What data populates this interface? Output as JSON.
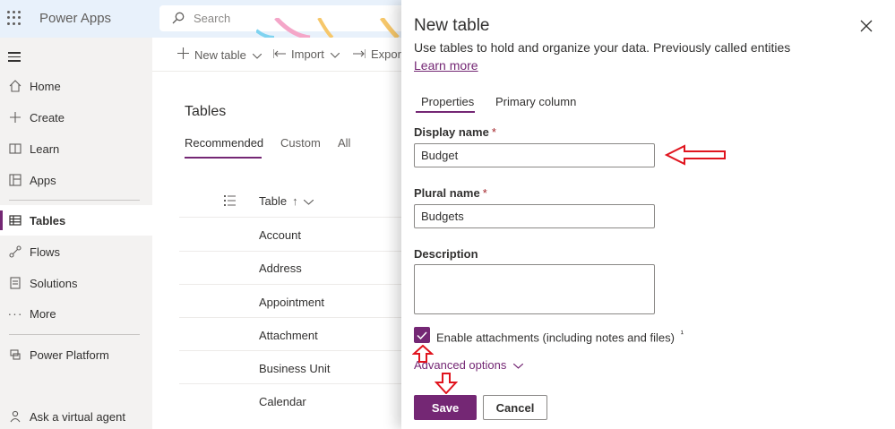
{
  "app": {
    "name": "Power Apps"
  },
  "search": {
    "placeholder": "Search"
  },
  "nav": {
    "items": [
      {
        "label": "Home",
        "icon": "home-icon"
      },
      {
        "label": "Create",
        "icon": "plus-icon"
      },
      {
        "label": "Learn",
        "icon": "book-icon"
      },
      {
        "label": "Apps",
        "icon": "apps-icon"
      },
      {
        "label": "Tables",
        "icon": "table-icon",
        "active": true
      },
      {
        "label": "Flows",
        "icon": "flow-icon"
      },
      {
        "label": "Solutions",
        "icon": "solutions-icon"
      },
      {
        "label": "More",
        "icon": "more-icon"
      },
      {
        "label": "Power Platform",
        "icon": "power-platform-icon"
      },
      {
        "label": "Ask a virtual agent",
        "icon": "agent-icon"
      }
    ]
  },
  "commands": {
    "new_table": "New table",
    "import": "Import",
    "export": "Export"
  },
  "main": {
    "title": "Tables",
    "tabs": [
      "Recommended",
      "Custom",
      "All"
    ],
    "column_header": "Table",
    "rows": [
      "Account",
      "Address",
      "Appointment",
      "Attachment",
      "Business Unit",
      "Calendar"
    ]
  },
  "panel": {
    "title": "New table",
    "subtitle": "Use tables to hold and organize your data. Previously called entities",
    "learn_more": "Learn more",
    "tabs": [
      "Properties",
      "Primary column"
    ],
    "display_name_label": "Display name",
    "display_name_value": "Budget",
    "plural_name_label": "Plural name",
    "plural_name_value": "Budgets",
    "required_mark": "*",
    "description_label": "Description",
    "description_value": "",
    "attachments_label": "Enable attachments (including notes and files)",
    "attachments_footnote": "¹",
    "attachments_checked": true,
    "advanced_options": "Advanced options",
    "save": "Save",
    "cancel": "Cancel"
  },
  "colors": {
    "accent": "#742774",
    "annotation": "#e0141e",
    "topbar": "#e8f1fb"
  }
}
